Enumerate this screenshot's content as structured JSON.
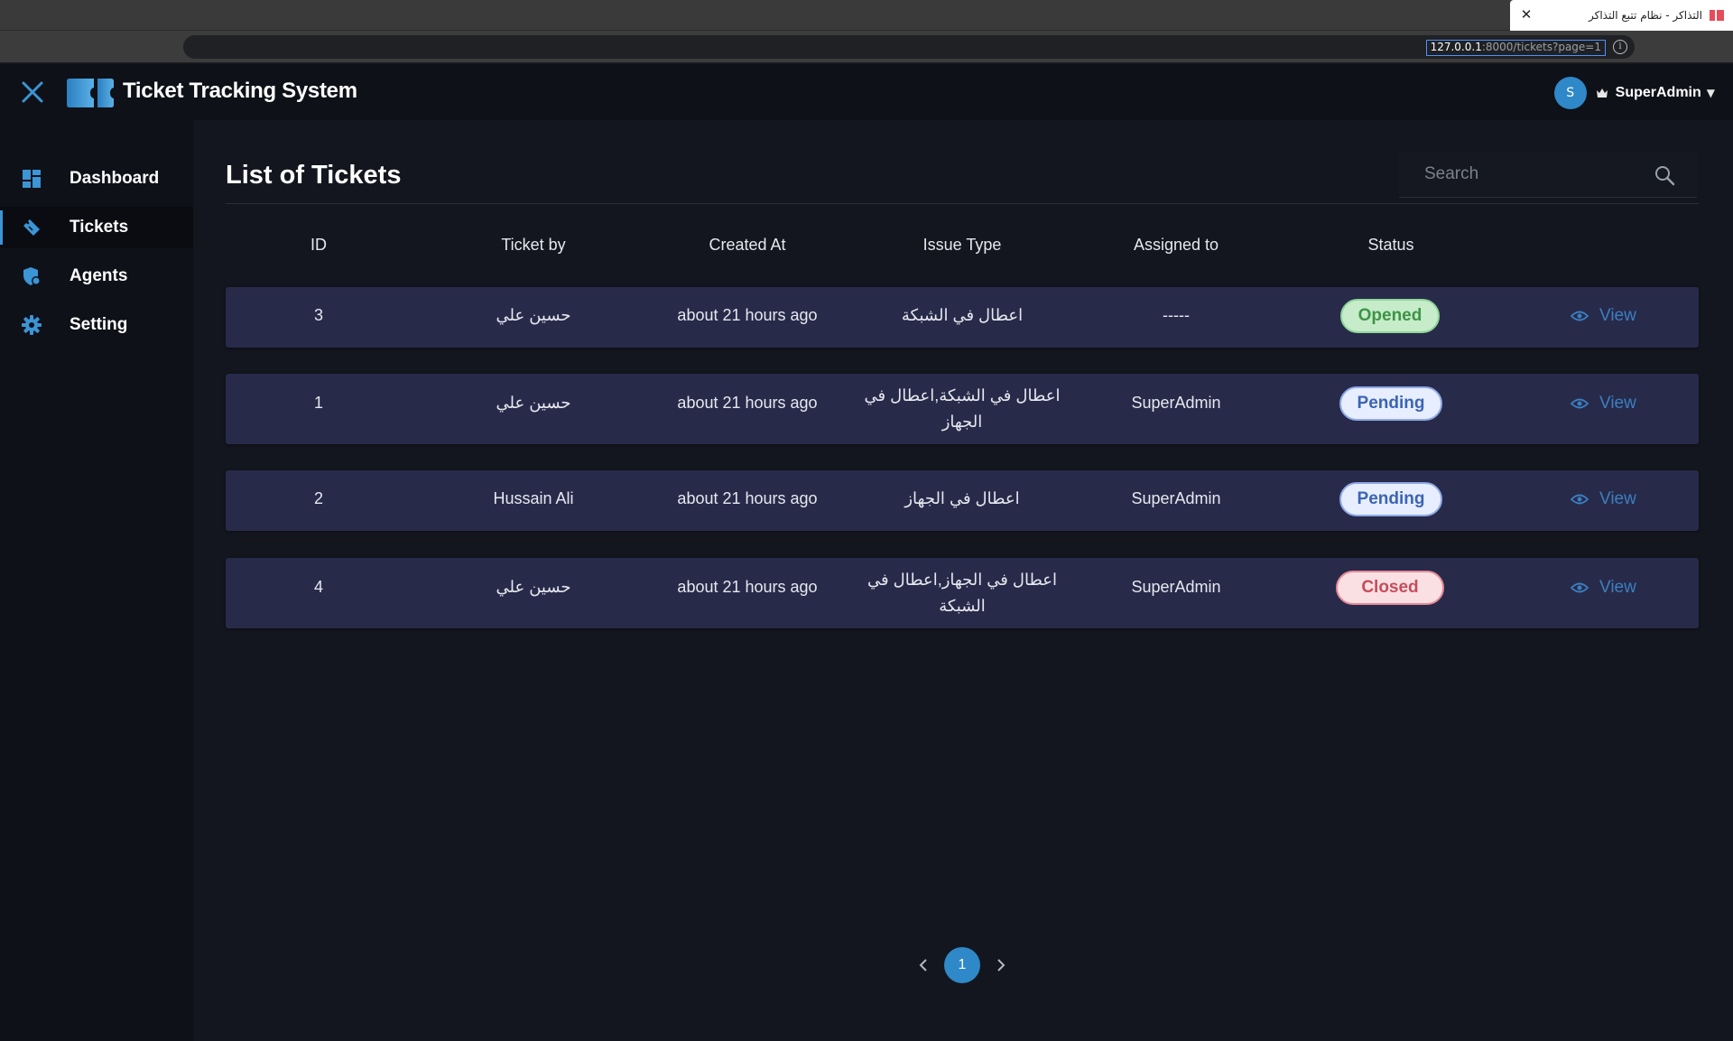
{
  "browser": {
    "tab_title": "التذاكر - نظام تتبع التذاكر",
    "url_host": "127.0.0.1",
    "url_rest": ":8000/tickets?page=1"
  },
  "header": {
    "app_title": "Ticket Tracking System",
    "user_initial": "S",
    "user_name": "SuperAdmin"
  },
  "sidebar": {
    "items": [
      {
        "label": "Dashboard",
        "icon": "dashboard-icon"
      },
      {
        "label": "Tickets",
        "icon": "ticket-icon",
        "active": true
      },
      {
        "label": "Agents",
        "icon": "agents-shield-icon"
      },
      {
        "label": "Setting",
        "icon": "gear-icon"
      }
    ]
  },
  "main": {
    "title": "List of Tickets",
    "search_placeholder": "Search",
    "columns": [
      "ID",
      "Ticket by",
      "Created At",
      "Issue Type",
      "Assigned to",
      "Status"
    ],
    "rows": [
      {
        "id": "3",
        "ticket_by": "حسين علي",
        "created_at": "about 21 hours ago",
        "issue_type": "اعطال في الشبكة",
        "assigned_to": "-----",
        "status": "Opened",
        "action": "View"
      },
      {
        "id": "1",
        "ticket_by": "حسين علي",
        "created_at": "about 21 hours ago",
        "issue_type": "اعطال في الشبكة,اعطال في الجهاز",
        "assigned_to": "SuperAdmin",
        "status": "Pending",
        "action": "View"
      },
      {
        "id": "2",
        "ticket_by": "Hussain Ali",
        "created_at": "about 21 hours ago",
        "issue_type": "اعطال في الجهاز",
        "assigned_to": "SuperAdmin",
        "status": "Pending",
        "action": "View"
      },
      {
        "id": "4",
        "ticket_by": "حسين علي",
        "created_at": "about 21 hours ago",
        "issue_type": "اعطال في الجهاز,اعطال في الشبكة",
        "assigned_to": "SuperAdmin",
        "status": "Closed",
        "action": "View"
      }
    ]
  },
  "pagination": {
    "current_page": "1"
  },
  "colors": {
    "accent": "#2f88c8",
    "row_bg": "#282a4a",
    "opened": "#3d9446",
    "pending": "#3c64b4",
    "closed": "#c44d5c"
  }
}
